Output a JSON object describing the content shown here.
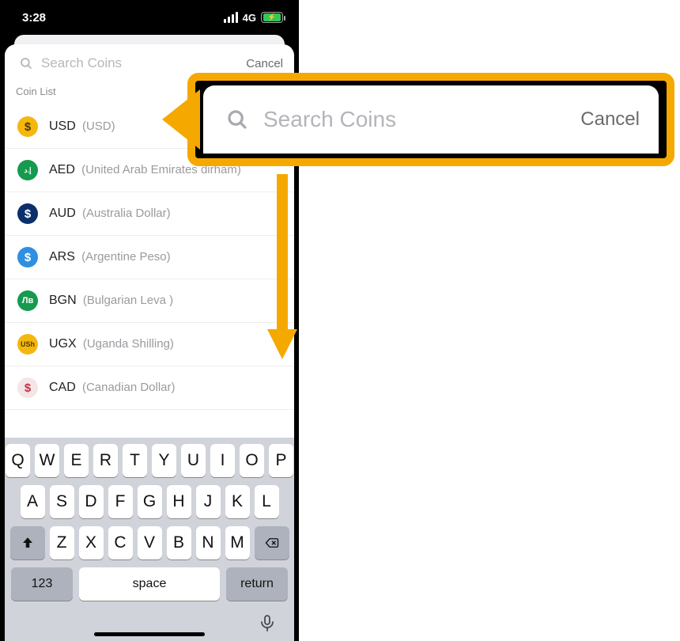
{
  "status": {
    "time": "3:28",
    "network": "4G"
  },
  "search": {
    "placeholder": "Search Coins",
    "cancel": "Cancel"
  },
  "section_label": "Coin List",
  "coins": [
    {
      "code": "USD",
      "name": "USD",
      "icon_bg": "#f5b70f",
      "icon_fg": "#4d3b00",
      "glyph": "$"
    },
    {
      "code": "AED",
      "name": "United Arab Emirates dirham",
      "icon_bg": "#169a4f",
      "icon_fg": "#ffffff",
      "glyph": "إ.د"
    },
    {
      "code": "AUD",
      "name": "Australia Dollar",
      "icon_bg": "#0b2f6b",
      "icon_fg": "#ffffff",
      "glyph": "$"
    },
    {
      "code": "ARS",
      "name": "Argentine Peso",
      "icon_bg": "#2f8fe0",
      "icon_fg": "#ffffff",
      "glyph": "$"
    },
    {
      "code": "BGN",
      "name": "Bulgarian Leva ",
      "icon_bg": "#169a4f",
      "icon_fg": "#ffffff",
      "glyph": "Лв"
    },
    {
      "code": "UGX",
      "name": "Uganda Shilling",
      "icon_bg": "#f5b70f",
      "icon_fg": "#4d3b00",
      "glyph": "USh"
    },
    {
      "code": "CAD",
      "name": "Canadian Dollar",
      "icon_bg": "#f4e5e6",
      "icon_fg": "#c2304a",
      "glyph": "$"
    }
  ],
  "keyboard": {
    "row1": [
      "Q",
      "W",
      "E",
      "R",
      "T",
      "Y",
      "U",
      "I",
      "O",
      "P"
    ],
    "row2": [
      "A",
      "S",
      "D",
      "F",
      "G",
      "H",
      "J",
      "K",
      "L"
    ],
    "row3": [
      "Z",
      "X",
      "C",
      "V",
      "B",
      "N",
      "M"
    ],
    "numkey": "123",
    "space": "space",
    "return": "return"
  },
  "callout": {
    "placeholder": "Search Coins",
    "cancel": "Cancel"
  }
}
